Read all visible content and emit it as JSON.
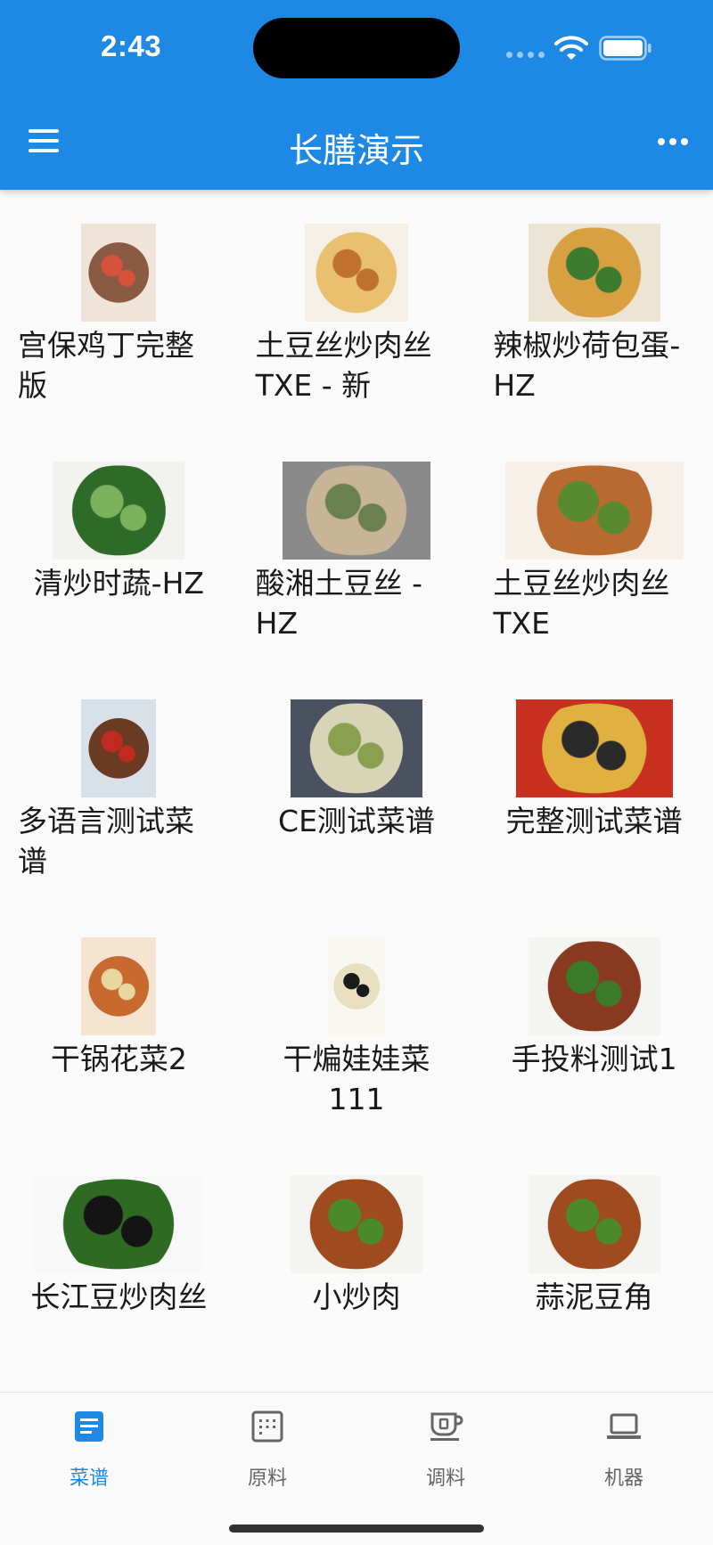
{
  "status_bar": {
    "time": "2:43"
  },
  "app_bar": {
    "title": "长膳演示",
    "menu_icon": "hamburger-menu-icon",
    "more_icon": "more-horizontal-icon"
  },
  "recipes": [
    {
      "name": "宫保鸡丁完整版",
      "image_colors": [
        "#8a5a44",
        "#d6523a",
        "#f0e4d8"
      ]
    },
    {
      "name": "土豆丝炒肉丝TXE - 新",
      "image_colors": [
        "#e8c070",
        "#c07030",
        "#f4f0e8"
      ]
    },
    {
      "name": "辣椒炒荷包蛋-HZ",
      "image_colors": [
        "#d8a040",
        "#3c7a30",
        "#ece4d4"
      ]
    },
    {
      "name": "清炒时蔬-HZ",
      "image_colors": [
        "#2e6a28",
        "#7cb05c",
        "#f2f2ee"
      ]
    },
    {
      "name": "酸湘土豆丝 - HZ",
      "image_colors": [
        "#c8b498",
        "#6a8050",
        "#8a8a8a"
      ]
    },
    {
      "name": "土豆丝炒肉丝TXE",
      "image_colors": [
        "#b86a30",
        "#5a8a30",
        "#f6f0e8"
      ]
    },
    {
      "name": "多语言测试菜谱",
      "image_colors": [
        "#6a3a22",
        "#c02a20",
        "#d8e0e8"
      ]
    },
    {
      "name": "CE测试菜谱",
      "image_colors": [
        "#d8d4b8",
        "#8aa050",
        "#4a5260"
      ]
    },
    {
      "name": "完整测试菜谱",
      "image_colors": [
        "#e0b040",
        "#2a2a2a",
        "#c83020"
      ]
    },
    {
      "name": "干锅花菜2",
      "image_colors": [
        "#c86a30",
        "#e8d8a0",
        "#f4e4d0"
      ]
    },
    {
      "name": "干煸娃娃菜111",
      "image_colors": [
        "#e8e0c0",
        "#1a1a1a",
        "#f8f8f0"
      ]
    },
    {
      "name": "手投料测试1",
      "image_colors": [
        "#8a3a20",
        "#3a7a28",
        "#f4f4f0"
      ]
    },
    {
      "name": "长江豆炒肉丝",
      "image_colors": [
        "#2e6a22",
        "#141414",
        "#f8f8f8"
      ]
    },
    {
      "name": "小炒肉",
      "image_colors": [
        "#a04a20",
        "#4a8a28",
        "#f4f4f0"
      ]
    },
    {
      "name": "蒜泥豆角",
      "image_colors": [
        "#a04a20",
        "#4a8a28",
        "#f4f4f0"
      ]
    }
  ],
  "bottom_nav": [
    {
      "label": "菜谱",
      "icon": "recipe-book-icon",
      "active": true
    },
    {
      "label": "原料",
      "icon": "ingredients-grid-icon",
      "active": false
    },
    {
      "label": "调料",
      "icon": "seasoning-cup-icon",
      "active": false
    },
    {
      "label": "机器",
      "icon": "laptop-machine-icon",
      "active": false
    }
  ],
  "colors": {
    "accent": "#1e88e5",
    "background": "#fafafa",
    "nav_inactive": "#666666"
  }
}
